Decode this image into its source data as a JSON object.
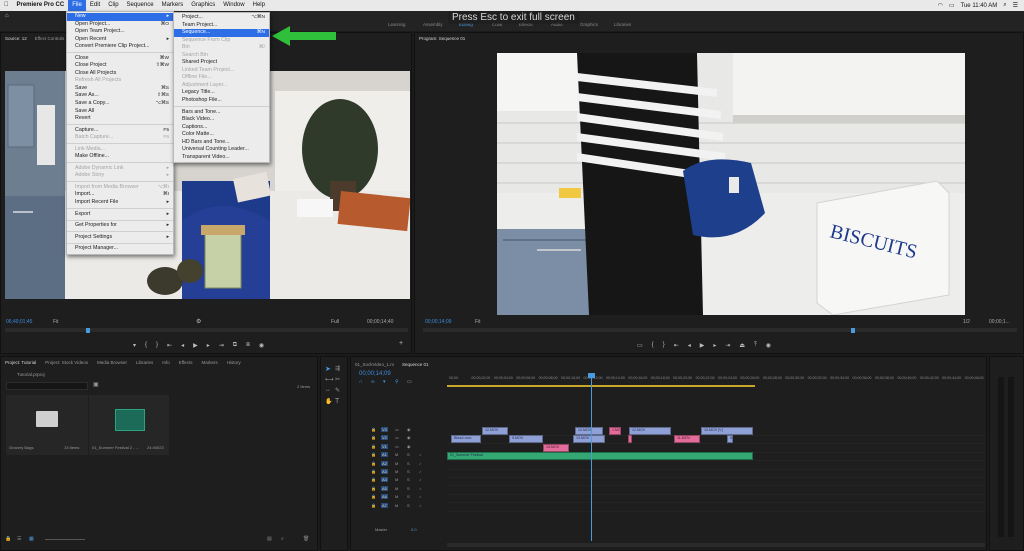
{
  "menubar": {
    "apple_icon": "apple-icon",
    "app_name": "Premiere Pro CC",
    "items": [
      "File",
      "Edit",
      "Clip",
      "Sequence",
      "Markers",
      "Graphics",
      "Window",
      "Help"
    ],
    "active": "File",
    "clock": "Tue 11:40 AM"
  },
  "workspace": {
    "items": [
      "Learning",
      "Assembly",
      "Editing",
      "Color",
      "Effects",
      "Audio",
      "Graphics",
      "Libraries"
    ],
    "active": "Editing"
  },
  "fullscreen_hint": "Press  Esc  to exit full screen",
  "file_menu": {
    "items": [
      {
        "label": "New",
        "shortcut": "",
        "submenu": true,
        "highlight": true,
        "disabled": false
      },
      {
        "label": "Open Project...",
        "shortcut": "⌘O",
        "disabled": false
      },
      {
        "label": "Open Team Project...",
        "shortcut": "",
        "disabled": false
      },
      {
        "label": "Open Recent",
        "shortcut": "",
        "submenu": true,
        "disabled": false
      },
      {
        "label": "Convert Premiere Clip Project...",
        "shortcut": "",
        "disabled": false
      },
      {
        "sep": true
      },
      {
        "label": "Close",
        "shortcut": "⌘W",
        "disabled": false
      },
      {
        "label": "Close Project",
        "shortcut": "⇧⌘W",
        "disabled": false
      },
      {
        "label": "Close All Projects",
        "shortcut": "",
        "disabled": false
      },
      {
        "label": "Refresh All Projects",
        "shortcut": "",
        "disabled": true
      },
      {
        "label": "Save",
        "shortcut": "⌘S",
        "disabled": false
      },
      {
        "label": "Save As...",
        "shortcut": "⇧⌘S",
        "disabled": false
      },
      {
        "label": "Save a Copy...",
        "shortcut": "⌥⌘S",
        "disabled": false
      },
      {
        "label": "Save All",
        "shortcut": "",
        "disabled": false
      },
      {
        "label": "Revert",
        "shortcut": "",
        "disabled": false
      },
      {
        "sep": true
      },
      {
        "label": "Capture...",
        "shortcut": "F5",
        "disabled": false
      },
      {
        "label": "Batch Capture...",
        "shortcut": "F6",
        "disabled": true
      },
      {
        "sep": true
      },
      {
        "label": "Link Media...",
        "shortcut": "",
        "disabled": true
      },
      {
        "label": "Make Offline...",
        "shortcut": "",
        "disabled": false
      },
      {
        "sep": true
      },
      {
        "label": "Adobe Dynamic Link",
        "shortcut": "",
        "submenu": true,
        "disabled": true
      },
      {
        "label": "Adobe Story",
        "shortcut": "",
        "submenu": true,
        "disabled": true
      },
      {
        "sep": true
      },
      {
        "label": "Import from Media Browser",
        "shortcut": "⌥⌘I",
        "disabled": true
      },
      {
        "label": "Import...",
        "shortcut": "⌘I",
        "disabled": false
      },
      {
        "label": "Import Recent File",
        "shortcut": "",
        "submenu": true,
        "disabled": false
      },
      {
        "sep": true
      },
      {
        "label": "Export",
        "shortcut": "",
        "submenu": true,
        "disabled": false
      },
      {
        "sep": true
      },
      {
        "label": "Get Properties for",
        "shortcut": "",
        "submenu": true,
        "disabled": false
      },
      {
        "sep": true
      },
      {
        "label": "Project Settings",
        "shortcut": "",
        "submenu": true,
        "disabled": false
      },
      {
        "sep": true
      },
      {
        "label": "Project Manager...",
        "shortcut": "",
        "disabled": false
      }
    ]
  },
  "new_submenu": {
    "items": [
      {
        "label": "Project...",
        "shortcut": "⌥⌘N",
        "disabled": false
      },
      {
        "label": "Team Project...",
        "shortcut": "",
        "disabled": false
      },
      {
        "label": "Sequence...",
        "shortcut": "⌘N",
        "disabled": false,
        "highlight": true
      },
      {
        "label": "Sequence From Clip",
        "shortcut": "",
        "disabled": true
      },
      {
        "label": "Bin",
        "shortcut": "⌘/",
        "disabled": true
      },
      {
        "label": "Search Bin",
        "shortcut": "",
        "disabled": true
      },
      {
        "label": "Shared Project",
        "shortcut": "",
        "disabled": false
      },
      {
        "label": "Linked Team Project...",
        "shortcut": "",
        "disabled": true
      },
      {
        "label": "Offline File...",
        "shortcut": "",
        "disabled": true
      },
      {
        "label": "Adjustment Layer...",
        "shortcut": "",
        "disabled": true
      },
      {
        "label": "Legacy Title...",
        "shortcut": "",
        "disabled": false
      },
      {
        "label": "Photoshop File...",
        "shortcut": "",
        "disabled": false
      },
      {
        "sep": true
      },
      {
        "label": "Bars and Tone...",
        "shortcut": "",
        "disabled": false
      },
      {
        "label": "Black Video...",
        "shortcut": "",
        "disabled": false
      },
      {
        "label": "Captions...",
        "shortcut": "",
        "disabled": false
      },
      {
        "label": "Color Matte...",
        "shortcut": "",
        "disabled": false
      },
      {
        "label": "HD Bars and Tone...",
        "shortcut": "",
        "disabled": false
      },
      {
        "label": "Universal Counting Leader...",
        "shortcut": "",
        "disabled": false
      },
      {
        "label": "Transparent Video...",
        "shortcut": "",
        "disabled": false
      }
    ]
  },
  "arrow_color": "#2fbf3a",
  "source_monitor": {
    "tab": "Source: 12",
    "tab2": "Effect Controls",
    "timecode": "06;49;01;45",
    "fit": "Fit",
    "quality": "Full",
    "duration": "00;00;14;40"
  },
  "program_monitor": {
    "tab": "Program: Sequence 01",
    "timecode": "00;00;14;09",
    "fit": "Fit",
    "quality": "1/2",
    "duration": "00;00;1..."
  },
  "project_panel": {
    "tabs": [
      "Project: Tutorial",
      "Project: Stock Videos",
      "Media Browser",
      "Libraries",
      "Info",
      "Effects",
      "Markers",
      "History"
    ],
    "file": "Tutorial.prproj",
    "count": "2 Items",
    "items": [
      {
        "name": "Grocery Bags",
        "meta": "13 Items",
        "icon": "folder-icon"
      },
      {
        "name": "01_Summer Festival 2 - ...",
        "meta": "24:40023",
        "icon": "audio-waveform-icon"
      }
    ]
  },
  "timeline": {
    "tabs": [
      "01_SockVideo_1.m",
      "Sequence 01"
    ],
    "timecode": "00;00;14;09",
    "ruler": [
      "00;00",
      "00;00;02;00",
      "00;00;04;00",
      "00;00;06;00",
      "00;00;08;00",
      "00;00;10;00",
      "00;00;12;00",
      "00;00;14;00",
      "00;00;16;00",
      "00;00;18;00",
      "00;00;20;00",
      "00;00;22;00",
      "00;00;24;00",
      "00;00;26;00",
      "00;00;28;00",
      "00;00;30;00",
      "00;00;32;00",
      "00;00;34;00",
      "00;00;36;00",
      "00;00;38;00",
      "00;00;40;00",
      "00;00;42;00",
      "00;00;44;00",
      "00;00;46;00",
      "00;00;48;00",
      "00;00;50;00",
      "00;00;52;00",
      "00;00;54;00",
      "00;00;56;00",
      "00;00;58;00",
      "00;01;00;00",
      "00;01;02;00",
      "00;01;04;00",
      "00;01;06;00",
      "00;01;08;00",
      "00;01;10;00",
      "00;01;12;00",
      "00;01;14;00",
      "00;01;16;00",
      "00;01;18;00",
      "00;01;20;00",
      "00;01;22;00",
      "00;01;24;00",
      "00;01;26;00",
      "00;01;28;00",
      "00;01;30;00",
      "00;01;32;00",
      "00;01;34;00",
      "00;01;36;00",
      "00;01;38;00",
      "00;01;40;00",
      "00;01;42;00",
      "00;01;44;00",
      "00;01;46;00",
      "00;01;48;00",
      "00;01;50;00",
      "00;01;52;00",
      "00;01;54;00",
      "00;01;56;00",
      "00;01;58;00",
      "00;02;00;00",
      "00;02;02;00",
      "00;02;04;00",
      "00;02;06;00",
      "00;02;08;00",
      "00;02;10;00",
      "00;02;12;00",
      "00;02;14;00",
      "00;02;16;00",
      "00;02;18;00",
      "00;02;20;00",
      "00;02;22;00",
      "00;02;24;00",
      "00;02;26;00",
      "00;02;28;00"
    ],
    "tracks_video": [
      "V3",
      "V2",
      "V1"
    ],
    "tracks_audio": [
      "A1",
      "A2",
      "A3",
      "A4",
      "A5",
      "A6",
      "A7"
    ],
    "master": "Master",
    "master_value": "0.0",
    "clips_v3": [
      {
        "label": "12.MOV"
      },
      {
        "label": "10.MOV"
      },
      {
        "label": "1.MOV"
      },
      {
        "label": "12.MOV"
      },
      {
        "label": "10.MOV [V]"
      }
    ],
    "clips_v2": [
      {
        "label": "Bliss4.mov"
      },
      {
        "label": "9.MOV"
      },
      {
        "label": "13.MOV"
      },
      {
        "label": "7.MOV"
      },
      {
        "label": "11.MOV"
      },
      {
        "label": "5.MOV"
      }
    ],
    "clips_v1": [
      {
        "label": "13.MOV"
      }
    ],
    "audio_clip": "01_Summer Festival"
  },
  "source_scrub_fraction": 0.2,
  "program_scrub_fraction": 0.72
}
